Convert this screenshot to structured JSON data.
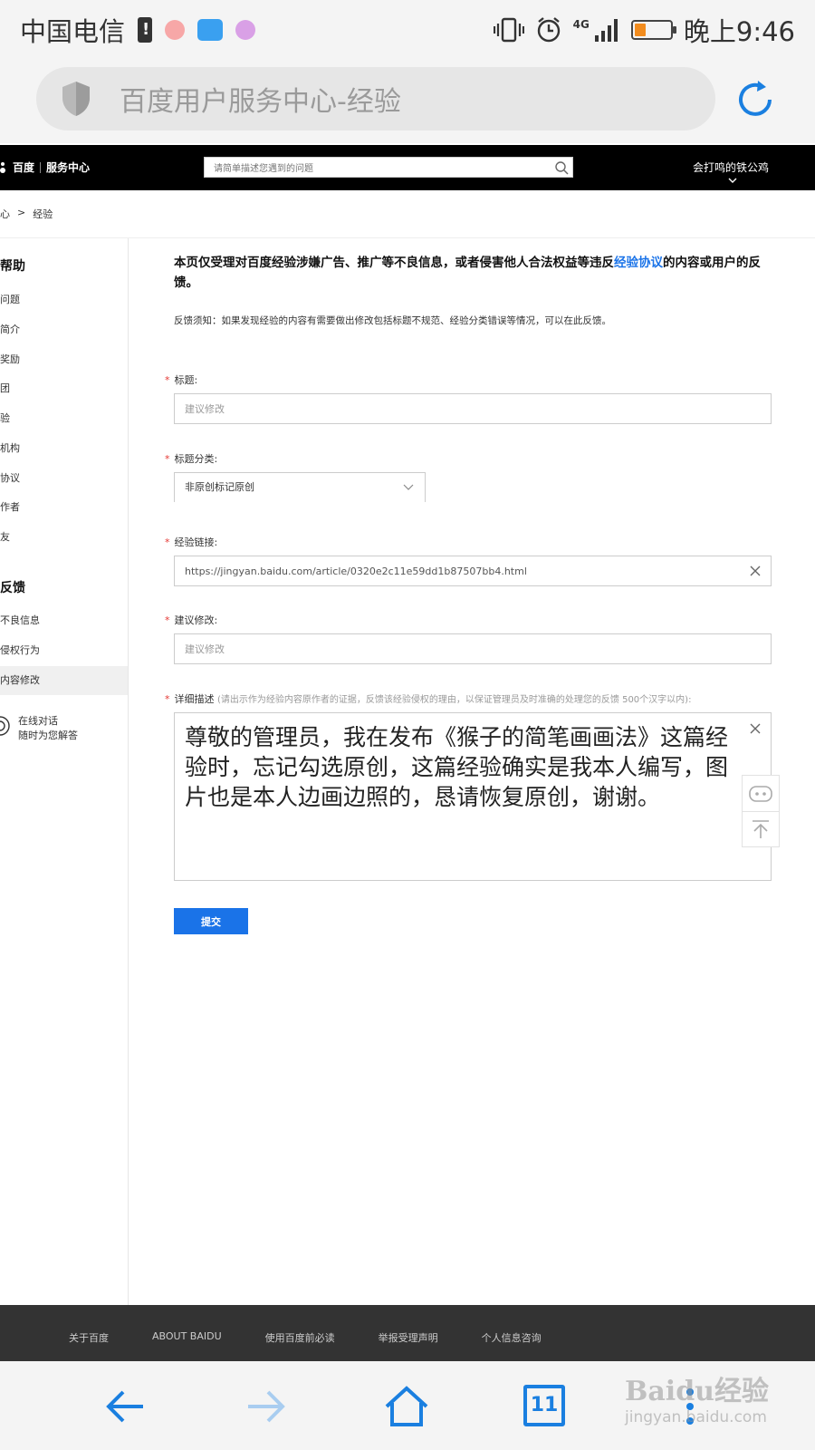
{
  "colors": {
    "accent": "#1a73e8",
    "required": "#e53935",
    "header_bg": "#000000",
    "footer_bg": "#333333"
  },
  "status_bar": {
    "carrier": "中国电信",
    "time": "晚上9:46",
    "network": "4G"
  },
  "address_bar": {
    "title": "百度用户服务中心-经验",
    "icon": "shield-icon"
  },
  "header": {
    "logo_brand": "百度",
    "logo_section": "服务中心",
    "search_placeholder": "请简单描述您遇到的问题",
    "user_name": "会打鸣的铁公鸡"
  },
  "breadcrumb": {
    "parent": "心",
    "sep": ">",
    "current": "经验"
  },
  "sidebar": {
    "group1": "帮助",
    "group1_items": [
      "问题",
      "简介",
      "奖励",
      "团",
      "验",
      "机构",
      "协议",
      "作者",
      "友"
    ],
    "group2": "反馈",
    "group2_items": [
      "不良信息",
      "侵权行为",
      "内容修改"
    ],
    "active_item": "内容修改",
    "chat_line1": "在线对话",
    "chat_line2": "随时为您解答"
  },
  "form": {
    "notice_part1": "本页仅受理对百度经验涉嫌广告、推广等不良信息，或者侵害他人合法权益等违反",
    "notice_link": "经验协议",
    "notice_part2": "的内容或用户的反馈。",
    "hint": "反馈须知：如果发现经验的内容有需要做出修改包括标题不规范、经验分类错误等情况，可以在此反馈。",
    "required_mark": "*",
    "title_label": "标题:",
    "title_placeholder": "建议修改",
    "category_label": "标题分类:",
    "category_value": "非原创标记原创",
    "link_label": "经验链接:",
    "link_value": "https://jingyan.baidu.com/article/0320e2c11e59dd1b87507bb4.html",
    "suggest_label": "建议修改:",
    "suggest_placeholder": "建议修改",
    "detail_label": "详细描述",
    "detail_hint": "(请出示作为经验内容原作者的证据，反馈该经验侵权的理由，以保证管理员及时准确的处理您的反馈 500个汉字以内):",
    "detail_value": "尊敬的管理员，我在发布《猴子的简笔画画法》这篇经验时，忘记勾选原创，这篇经验确实是我本人编写，图片也是本人边画边照的，恳请恢复原创，谢谢。",
    "submit_label": "提交"
  },
  "footer": {
    "links": [
      "关于百度",
      "ABOUT BAIDU",
      "使用百度前必读",
      "举报受理声明",
      "个人信息咨询"
    ]
  },
  "bottom_nav": {
    "tabs_count": "11"
  },
  "watermark": {
    "brand": "Baidu经验",
    "url": "jingyan.baidu.com"
  }
}
